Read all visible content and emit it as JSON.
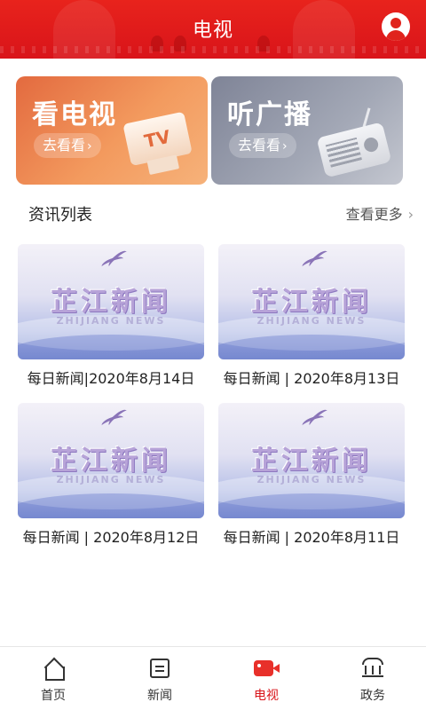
{
  "header": {
    "title": "电视"
  },
  "cards": [
    {
      "title": "看电视",
      "button": "去看看",
      "illustration_label": "TV"
    },
    {
      "title": "听广播",
      "button": "去看看"
    }
  ],
  "section": {
    "title": "资讯列表",
    "more": "查看更多"
  },
  "news": [
    {
      "caption": "每日新闻|2020年8月14日",
      "logo_cn": "芷江新闻",
      "logo_en": "ZHIJIANG NEWS"
    },
    {
      "caption": "每日新闻 | 2020年8月13日",
      "logo_cn": "芷江新闻",
      "logo_en": "ZHIJIANG NEWS"
    },
    {
      "caption": "每日新闻 | 2020年8月12日",
      "logo_cn": "芷江新闻",
      "logo_en": "ZHIJIANG NEWS"
    },
    {
      "caption": "每日新闻 | 2020年8月11日",
      "logo_cn": "芷江新闻",
      "logo_en": "ZHIJIANG NEWS"
    }
  ],
  "nav": [
    {
      "label": "首页",
      "icon": "home-icon",
      "active": false
    },
    {
      "label": "新闻",
      "icon": "news-icon",
      "active": false
    },
    {
      "label": "电视",
      "icon": "tv-icon",
      "active": true
    },
    {
      "label": "政务",
      "icon": "government-icon",
      "active": false
    }
  ],
  "colors": {
    "brand_red": "#d9141a",
    "tv_card": "#ef8a52",
    "radio_card": "#979cab"
  }
}
